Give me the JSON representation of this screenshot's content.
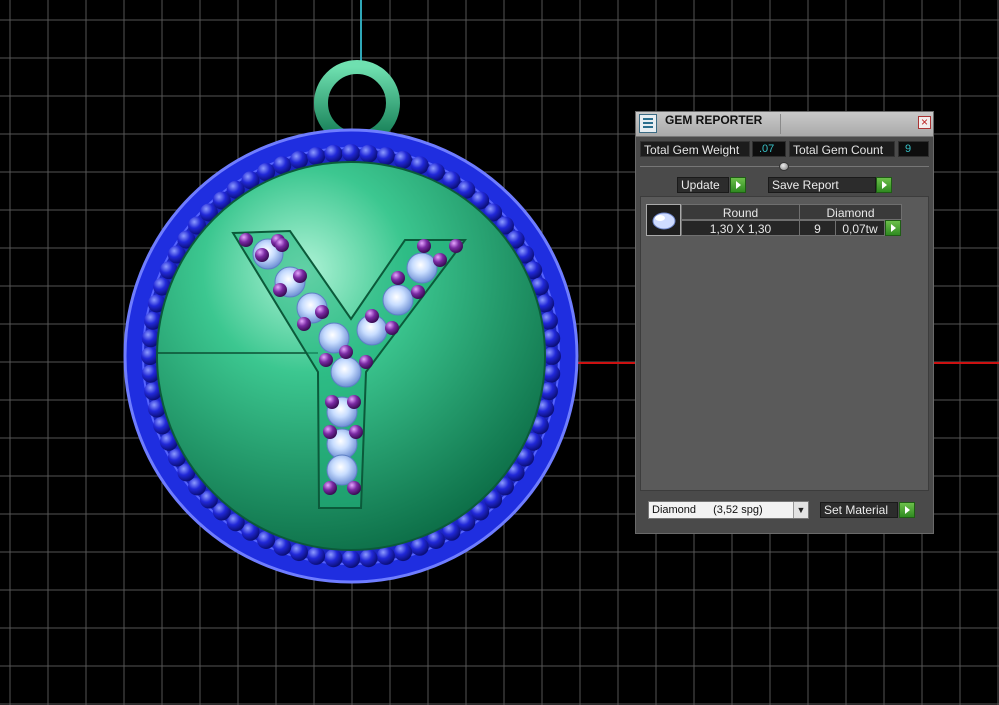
{
  "viewport": {
    "background": "#000000",
    "grid_color": "#555555",
    "axis_vertical_color": "#2fa7b8",
    "axis_horizontal_color": "#cc1111",
    "model": {
      "letter": "Y",
      "body_color": "#19a46e",
      "bezel_color": "#1f2ee0",
      "bead_color": "#2128d8",
      "ring_color": "#1ea877",
      "gem_color": "#b8d6ff",
      "prong_color": "#7a2aa3"
    }
  },
  "panel": {
    "title": "GEM REPORTER",
    "close_icon": "close-icon",
    "app_icon": "gem-reporter-icon",
    "total_gem_weight_label": "Total Gem Weight",
    "total_gem_weight_value": ".07",
    "total_gem_count_label": "Total Gem Count",
    "total_gem_count_value": "9",
    "update_label": "Update",
    "save_report_label": "Save Report",
    "gem_row": {
      "shape": "Round",
      "material": "Diamond",
      "size": "1,30 X 1,30",
      "count": "9",
      "weight": "0,07tw"
    },
    "material_select": {
      "material": "Diamond",
      "gravity": "(3,52 spg)"
    },
    "set_material_label": "Set Material"
  }
}
